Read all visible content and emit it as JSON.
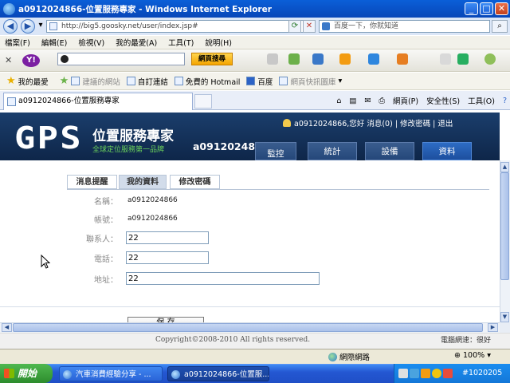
{
  "window": {
    "title": "a0912024866-位置服務專家 - Windows Internet Explorer",
    "minimize": "_",
    "maximize": "□",
    "close": "✕"
  },
  "addressbar": {
    "url": "http://big5.goosky.net/user/index.jsp#",
    "search_placeholder": "百度一下，你就知道",
    "back_icon": "back-arrow-icon",
    "forward_icon": "forward-arrow-icon"
  },
  "menubar": {
    "items": [
      "檔案(F)",
      "編輯(E)",
      "檢視(V)",
      "我的最愛(A)",
      "工具(T)",
      "說明(H)"
    ]
  },
  "yahoo_toolbar": {
    "logo": "Y!",
    "button_label": "網頁搜尋"
  },
  "favorites_bar": {
    "favorites_label": "我的最愛",
    "items": [
      "建議的網站",
      "自訂連結",
      "免費的 Hotmail",
      "百度",
      "網頁快訊圖庫"
    ]
  },
  "tabs": {
    "active_tab": "a0912024866-位置服務專家",
    "commands": [
      "網頁(P)",
      "安全性(S)",
      "工具(O)"
    ]
  },
  "site": {
    "logo": "GPS",
    "name": "位置服務專家",
    "tagline": "全球定位服務第一品牌",
    "username": "a0912024866",
    "greeting": "a0912024866,您好",
    "links": [
      "消息(0)",
      "修改密碼",
      "退出"
    ],
    "separator": "|",
    "nav": [
      "監控",
      "統計",
      "設備",
      "資料"
    ],
    "active_nav": "資料"
  },
  "profile": {
    "subtabs": [
      "消息提醒",
      "我的資料",
      "修改密碼"
    ],
    "active_subtab": "我的資料",
    "fields": [
      {
        "label": "名稱：",
        "value": "a0912024866"
      },
      {
        "label": "帳號：",
        "value": "a0912024866"
      },
      {
        "label": "聯系人：",
        "value": "22"
      },
      {
        "label": "電話：",
        "value": "22"
      },
      {
        "label": "地址：",
        "value": "22"
      }
    ],
    "save_label": "保 存"
  },
  "footer": {
    "copyright": "Copyright©2008-2010 All rights reserved.",
    "net_speed": "電腦網速：很好"
  },
  "statusbar": {
    "zone": "網際網路",
    "zoom": "100%"
  },
  "taskbar": {
    "start_label": "開始",
    "items": [
      "汽車消費經驗分享 - ...",
      "a0912024866-位置服..."
    ],
    "clock": "#1020205"
  }
}
